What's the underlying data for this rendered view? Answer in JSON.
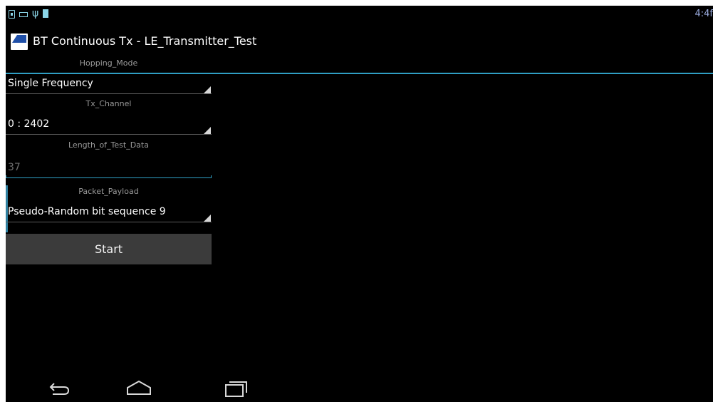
{
  "status_bar": {
    "icons": [
      "sim-card-icon",
      "keyboard-icon",
      "usb-icon",
      "battery-icon"
    ],
    "time": "4:4f"
  },
  "action_bar": {
    "app_icon": "app-logo-icon",
    "title": "BT Continuous Tx - LE_Transmitter_Test"
  },
  "form": {
    "hopping_mode": {
      "label": "Hopping_Mode",
      "value": "Single Frequency"
    },
    "tx_channel": {
      "label": "Tx_Channel",
      "value": "0 : 2402"
    },
    "length_of_test_data": {
      "label": "Length_of_Test_Data",
      "value": "37"
    },
    "packet_payload": {
      "label": "Packet_Payload",
      "value": "Pseudo-Random bit sequence 9"
    },
    "start_label": "Start"
  },
  "nav_bar": {
    "icons": [
      "back-icon",
      "home-icon",
      "recent-apps-icon"
    ]
  },
  "colors": {
    "background": "#000000",
    "accent": "#2f9fc4",
    "label": "#9a9a9a",
    "button": "#3b3b3b"
  }
}
